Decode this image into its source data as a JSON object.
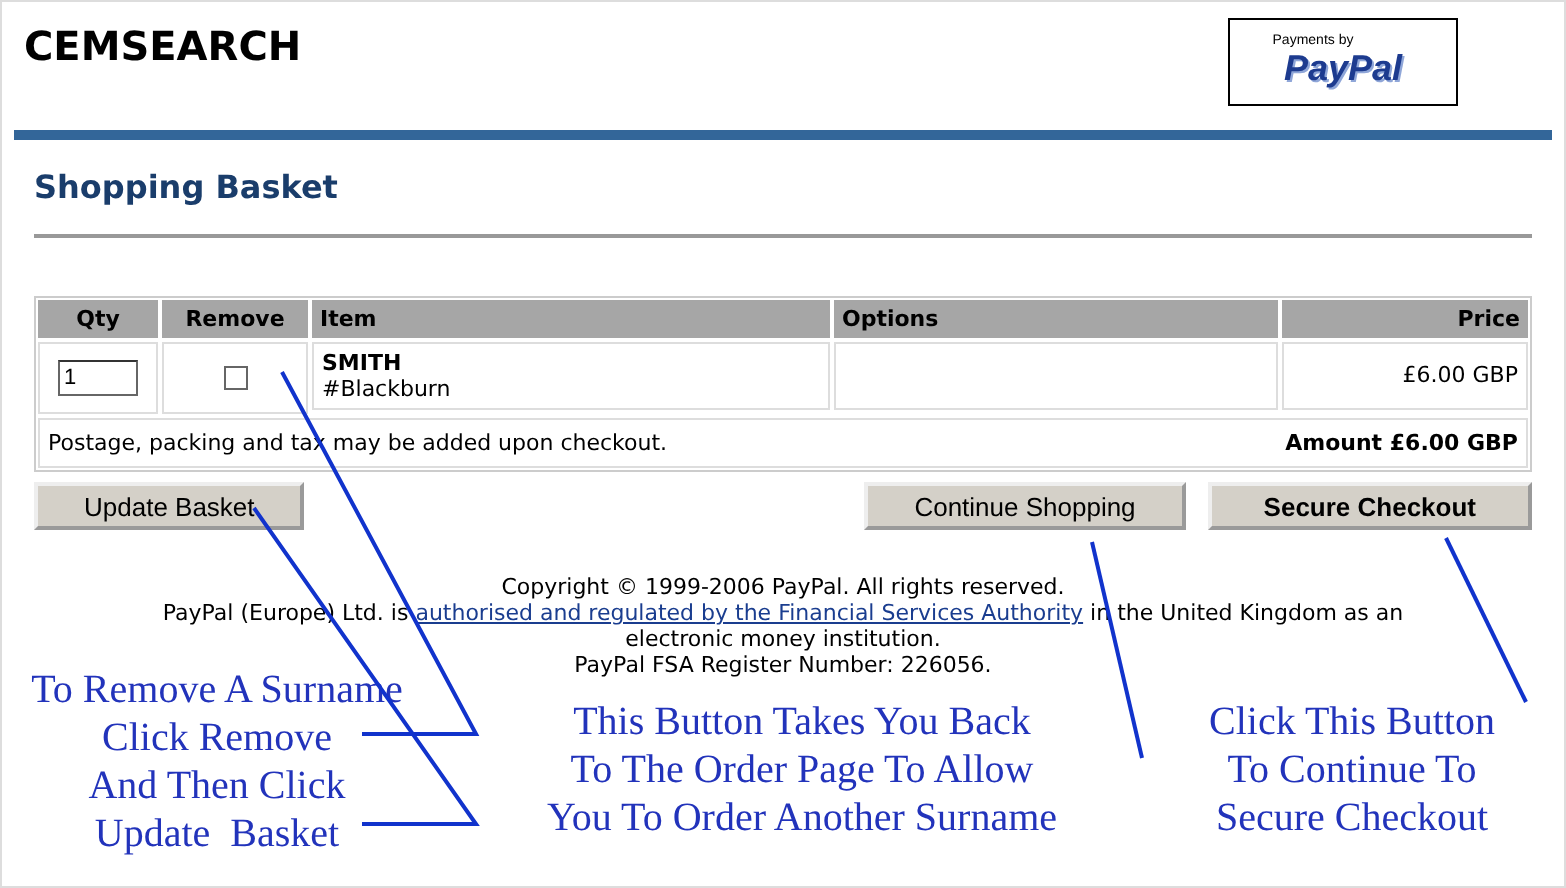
{
  "header": {
    "title": "CEMSEARCH",
    "badge": {
      "caption": "Payments by",
      "brand": "PayPal"
    }
  },
  "heading": "Shopping Basket",
  "table": {
    "columns": [
      "Qty",
      "Remove",
      "Item",
      "Options",
      "Price"
    ],
    "rows": [
      {
        "qty": "1",
        "remove_checked": false,
        "item": "SMITH",
        "item_detail": "#Blackburn",
        "price": "£6.00 GBP"
      }
    ],
    "note": "Postage, packing and tax may be added upon checkout.",
    "total": "Amount £6.00 GBP"
  },
  "buttons": [
    {
      "label": "Update Basket",
      "kind": "plain"
    },
    {
      "label": "Continue Shopping",
      "kind": "plain"
    },
    {
      "label": "Secure Checkout",
      "kind": "bold"
    }
  ],
  "legal": {
    "line1": "Copyright © 1999-2006 PayPal. All rights reserved.",
    "before_link": "PayPal (Europe) Ltd. is ",
    "link": "authorised and regulated by the Financial Services Authority",
    "after_link": " in the United Kingdom as an electronic money institution.",
    "line3": "PayPal FSA Register Number: 226056."
  },
  "annotations": [
    {
      "lines": [
        "To Remove A Surname",
        "Click Remove",
        "And Then Click",
        "Update  Basket"
      ]
    },
    {
      "lines": [
        "This Button Takes You Back",
        "To The Order Page To Allow",
        "You To Order Another Surname"
      ]
    },
    {
      "lines": [
        "Click This Button",
        "To Continue To",
        "Secure Checkout"
      ]
    }
  ]
}
